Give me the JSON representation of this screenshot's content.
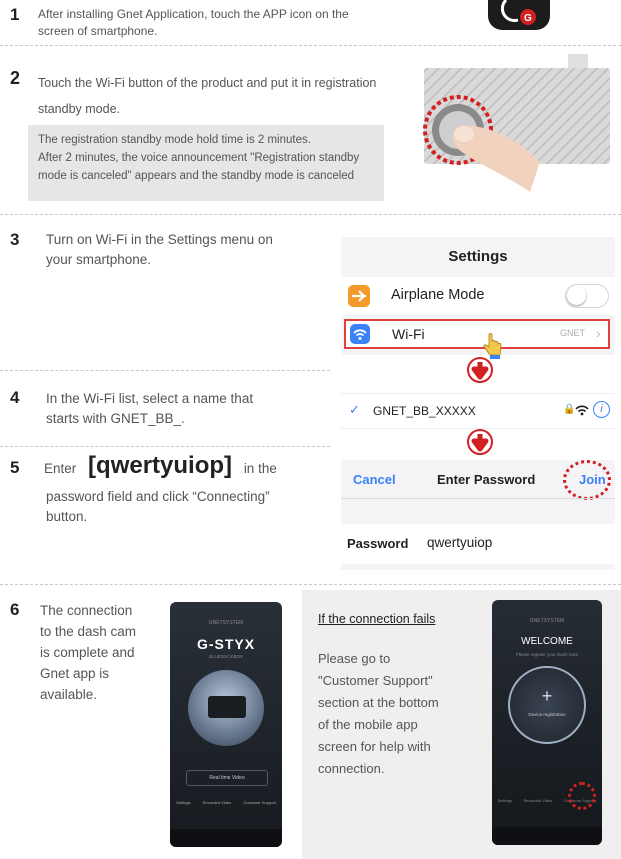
{
  "steps": [
    {
      "num": "1",
      "lines": [
        "After installing Gnet Application, touch the APP icon on the",
        "screen of smartphone."
      ]
    },
    {
      "num": "2",
      "lines": [
        "Touch the Wi-Fi button of the product and put it in registration",
        "standby mode."
      ]
    },
    {
      "num": "3",
      "lines": [
        "Turn on Wi-Fi in the Settings menu on",
        "your smartphone."
      ]
    },
    {
      "num": "4",
      "lines": [
        "In the Wi-Fi list, select a name that",
        "starts with GNET_BB_."
      ]
    },
    {
      "num": "5",
      "pre": "Enter",
      "password": "[qwertyuiop]",
      "post": "in the",
      "lines": [
        "password field and click “Connecting”",
        "button."
      ]
    },
    {
      "num": "6",
      "lines": [
        "The connection",
        "to the dash cam",
        "is complete and",
        "Gnet app is",
        "available."
      ]
    }
  ],
  "note": [
    "The registration standby mode hold time is 2 minutes.",
    "After 2 minutes, the voice announcement \"Registration standby",
    "mode is canceled\" appears and the standby mode is canceled"
  ],
  "settings": {
    "title": "Settings",
    "airplane": "Airplane Mode",
    "wifi": "Wi-Fi",
    "wifi_value": "GNET"
  },
  "wifi_list": {
    "network": "GNET_BB_XXXXX"
  },
  "password_screen": {
    "cancel": "Cancel",
    "title": "Enter Password",
    "join": "Join",
    "label": "Password",
    "value": "qwertyuiop"
  },
  "app_screen_1": {
    "header": "GNETSYSTEM",
    "brand": "G-STYX",
    "sub": "BLUEDUCKBOX",
    "live": "Real time Video",
    "nav": [
      "Settings",
      "Recorded Video",
      "Customer Support"
    ]
  },
  "fail_box": {
    "title": "If the connection fails",
    "lines": [
      "Please go to",
      "\"Customer Support\"",
      "section at the bottom",
      "of the mobile app",
      "screen for help with",
      "connection."
    ]
  },
  "app_screen_2": {
    "header": "GNETSYSTEM",
    "welcome": "WELCOME",
    "sub": "Please register your Dash Cam",
    "device": "Device registration",
    "nav": [
      "Settings",
      "Recorded Video",
      "Customer Support"
    ]
  },
  "colors": {
    "accent": "#d32020",
    "ios_blue": "#3b82f6",
    "wifi_highlight": "#e04040"
  }
}
